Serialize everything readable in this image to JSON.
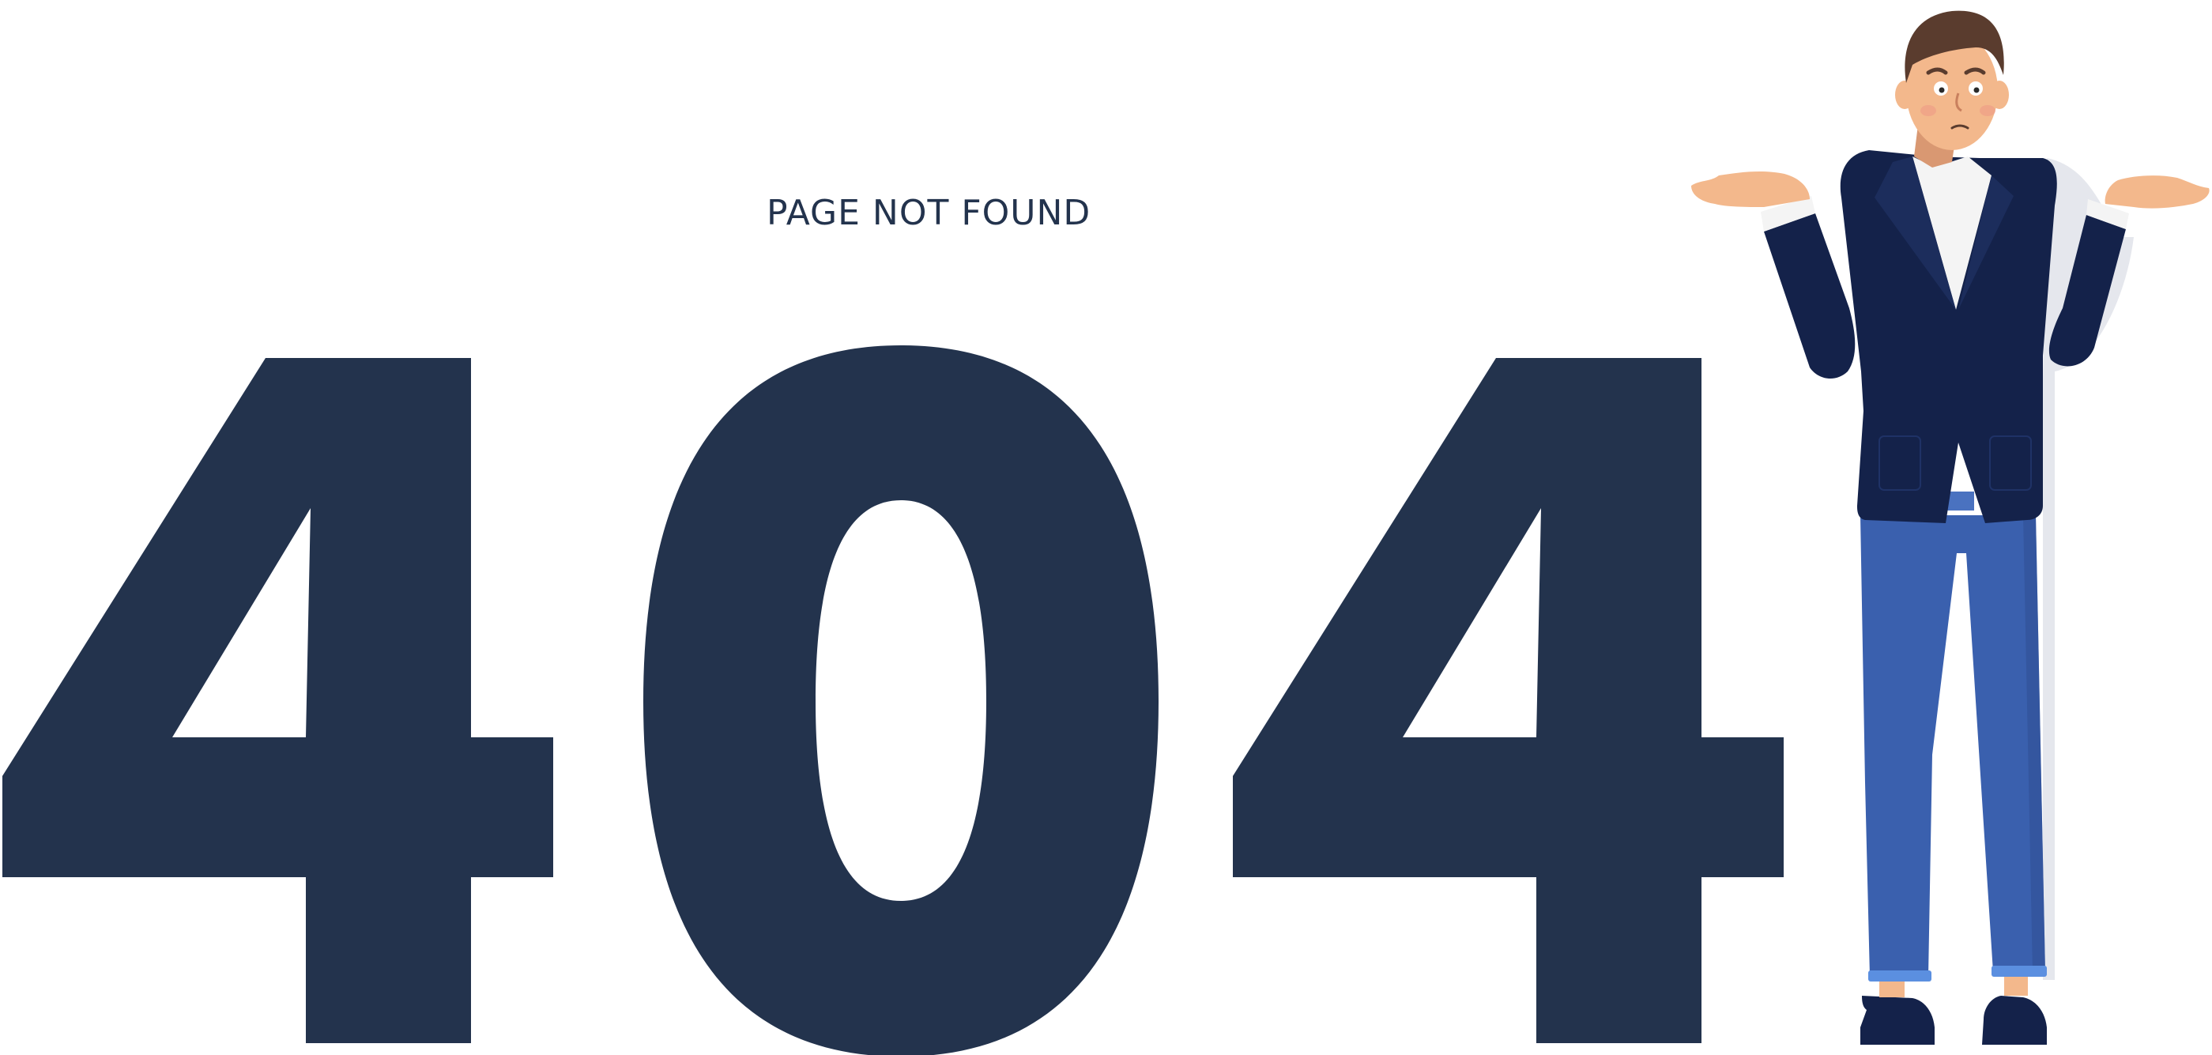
{
  "page": {
    "heading": "PAGE NOT FOUND",
    "code_digits": [
      "4",
      "0",
      "4"
    ]
  },
  "colors": {
    "digit": "#23334D",
    "jacket": "#14224A",
    "trousers": "#3A60AE",
    "skin": "#F3B88C",
    "hair": "#5A3C2E",
    "shirt": "#F4F4F4"
  },
  "illustration": {
    "name": "shrugging-man-illustration"
  }
}
